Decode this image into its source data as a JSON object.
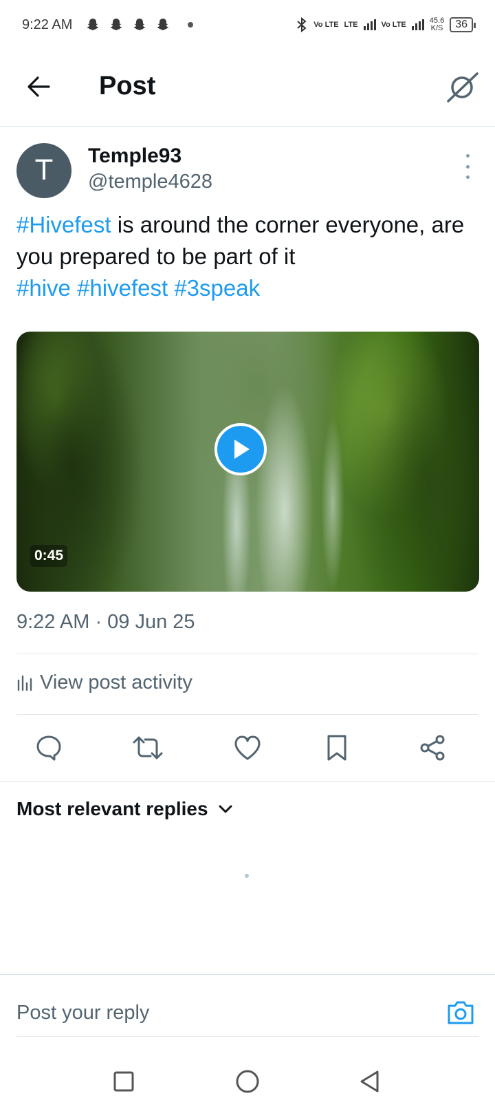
{
  "status_bar": {
    "time": "9:22 AM",
    "net1": "Vo LTE",
    "net2": "LTE",
    "net3": "Vo LTE",
    "speed": "45.6",
    "speed_unit": "K/S",
    "battery": "36"
  },
  "header": {
    "title": "Post"
  },
  "post": {
    "author_initial": "T",
    "display_name": "Temple93",
    "handle": "@temple4628",
    "text_hashtag_1": "#Hivefest",
    "text_body": " is around the corner everyone, are you prepared to be part of it",
    "hashtags": [
      "#hive",
      "#hivefest",
      "#3speak"
    ],
    "video_duration": "0:45",
    "timestamp": "9:22 AM · 09 Jun 25"
  },
  "activity": {
    "label": "View post activity"
  },
  "actions": [
    "reply",
    "repost",
    "like",
    "bookmark",
    "share"
  ],
  "replies": {
    "sort_label": "Most relevant replies"
  },
  "composer": {
    "placeholder": "Post your reply"
  },
  "colors": {
    "accent": "#1d9bf0",
    "text": "#0f1419",
    "secondary": "#536471",
    "avatar_bg": "#4a5b66"
  }
}
